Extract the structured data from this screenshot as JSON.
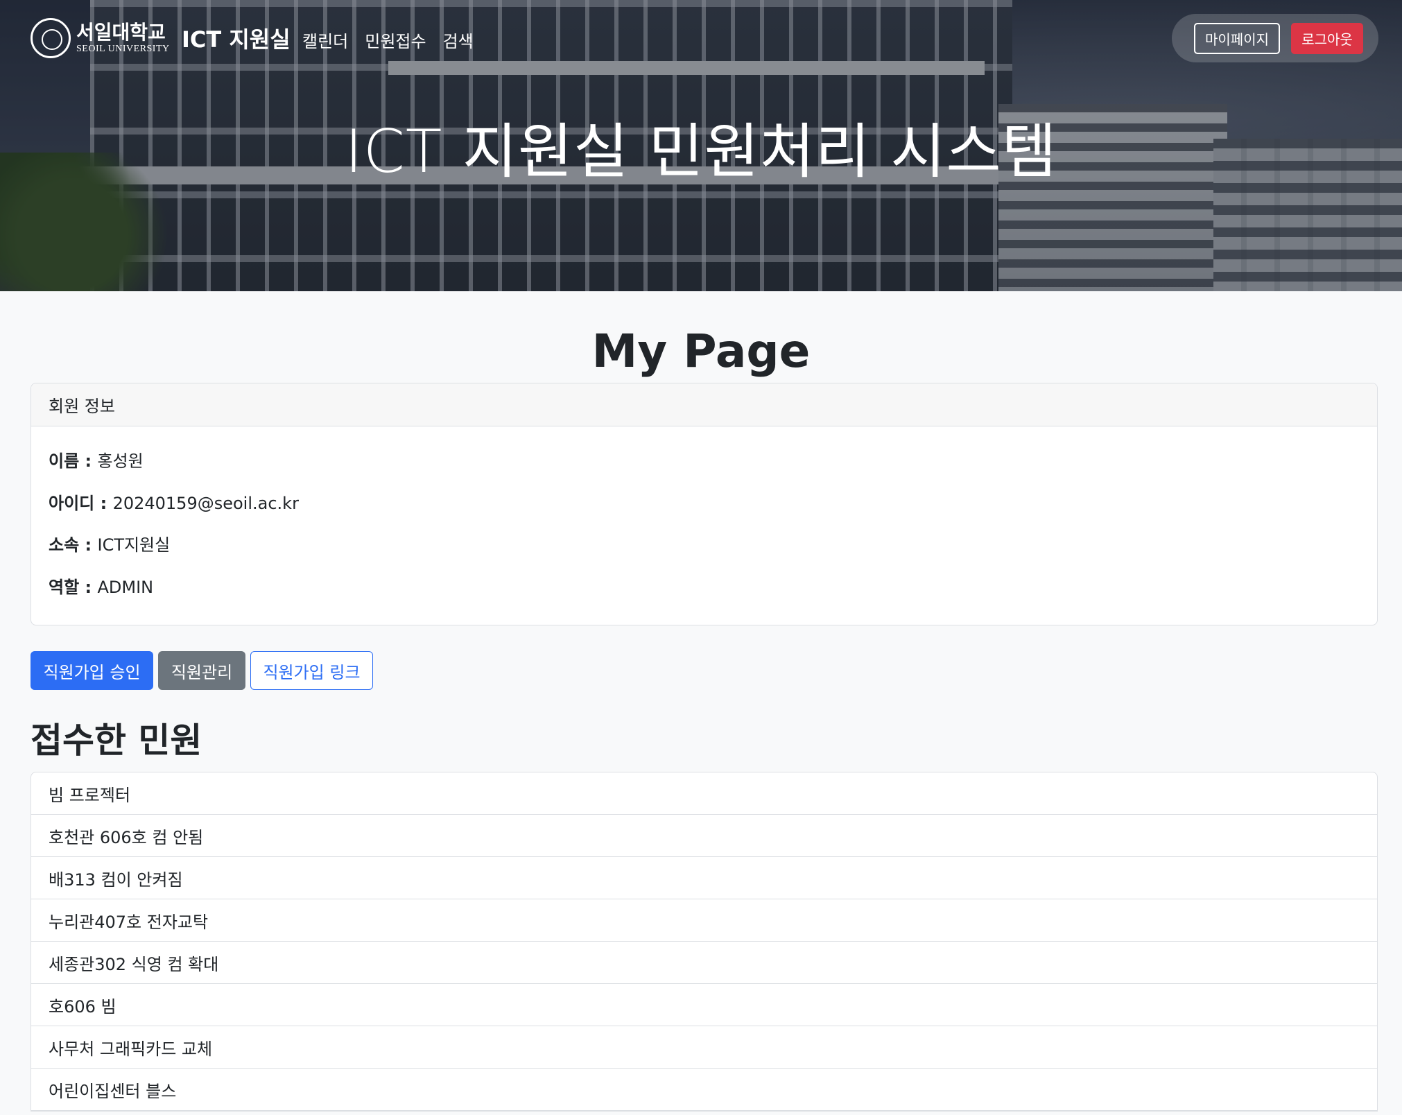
{
  "header": {
    "logo_kr": "서일대학교",
    "logo_en": "SEOIL UNIVERSITY",
    "brand": "ICT 지원실",
    "nav": [
      "캘린더",
      "민원접수",
      "검색"
    ],
    "mypage_label": "마이페이지",
    "logout_label": "로그아웃",
    "logout_color": "#dc3545",
    "hero_title": "ICT 지원실 민원처리 시스템"
  },
  "main": {
    "page_title": "My Page",
    "member_card": {
      "header": "회원 정보",
      "fields": [
        {
          "label": "이름",
          "value": "홍성원"
        },
        {
          "label": "아이디",
          "value": "20240159@seoil.ac.kr"
        },
        {
          "label": "소속",
          "value": "ICT지원실"
        },
        {
          "label": "역할",
          "value": "ADMIN"
        }
      ]
    },
    "buttons": {
      "approve": "직원가입 승인",
      "manage": "직원관리",
      "signup_link": "직원가입 링크"
    },
    "accent_color": "#2c6df4",
    "received_title": "접수한 민원",
    "received_items": [
      "빔 프로젝터",
      "호천관 606호 컴 안됨",
      "배313 컴이 안켜짐",
      "누리관407호 전자교탁",
      "세종관302 식영 컴 확대",
      "호606 빔",
      "사무처 그래픽카드 교체",
      "어린이집센터 블스"
    ]
  }
}
